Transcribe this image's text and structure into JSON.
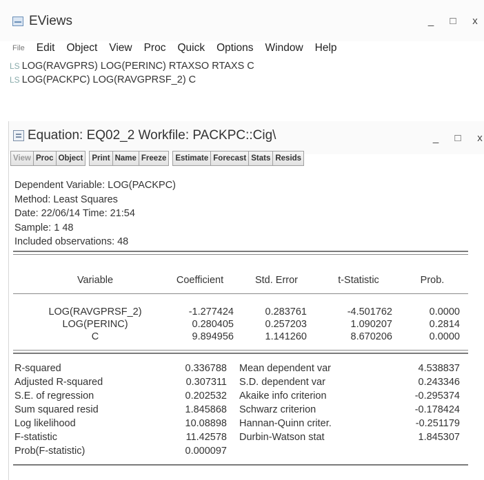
{
  "app": {
    "title": "EViews",
    "window_controls": {
      "minimize": "_",
      "maximize": "□",
      "close": "x"
    }
  },
  "menu": {
    "items": [
      {
        "key": "file",
        "label": "File"
      },
      {
        "key": "edit",
        "label": "Edit"
      },
      {
        "key": "object",
        "label": "Object"
      },
      {
        "key": "view",
        "label": "View"
      },
      {
        "key": "proc",
        "label": "Proc"
      },
      {
        "key": "quick",
        "label": "Quick"
      },
      {
        "key": "options",
        "label": "Options"
      },
      {
        "key": "window",
        "label": "Window"
      },
      {
        "key": "help",
        "label": "Help"
      }
    ]
  },
  "command_window": {
    "lines": [
      {
        "prefix": "LS",
        "text": "LOG(RAVGPRS) LOG(PERINC)  RTAXSO RTAXS C"
      },
      {
        "prefix": "LS",
        "text": "LOG(PACKPC) LOG(RAVGPRSF_2) C"
      }
    ]
  },
  "equation_window": {
    "title": "Equation: EQ02_2   Workfile: PACKPC::Cig\\",
    "window_controls": {
      "minimize": "_",
      "maximize": "□",
      "close": "x"
    },
    "toolbar": [
      {
        "label": "View"
      },
      {
        "label": "Proc"
      },
      {
        "label": "Object"
      },
      {
        "label": "Print"
      },
      {
        "label": "Name"
      },
      {
        "label": "Freeze"
      },
      {
        "label": "Estimate"
      },
      {
        "label": "Forecast"
      },
      {
        "label": "Stats"
      },
      {
        "label": "Resids"
      }
    ],
    "header": {
      "dependent_variable": "Dependent Variable: LOG(PACKPC)",
      "method": "Method: Least Squares",
      "date": "Date: 22/06/14   Time: 21:54",
      "sample": "Sample: 1 48",
      "observations": "Included observations: 48"
    },
    "columns": [
      "Variable",
      "Coefficient",
      "Std. Error",
      "t-Statistic",
      "Prob."
    ],
    "rows": [
      [
        "LOG(RAVGPRSF_2)",
        "-1.277424",
        "0.283761",
        "-4.501762",
        "0.0000"
      ],
      [
        "LOG(PERINC)",
        "0.280405",
        "0.257203",
        "1.090207",
        "0.2814"
      ],
      [
        "C",
        "9.894956",
        "1.141260",
        "8.670206",
        "0.0000"
      ]
    ],
    "stats": [
      {
        "label": "R-squared",
        "value": "0.336788",
        "label2": "Mean dependent var",
        "value2": "4.538837"
      },
      {
        "label": "Adjusted R-squared",
        "value": "0.307311",
        "label2": "S.D. dependent var",
        "value2": "0.243346"
      },
      {
        "label": "S.E. of regression",
        "value": "0.202532",
        "label2": "Akaike info criterion",
        "value2": "-0.295374"
      },
      {
        "label": "Sum squared resid",
        "value": "1.845868",
        "label2": "Schwarz criterion",
        "value2": "-0.178424"
      },
      {
        "label": "Log likelihood",
        "value": "10.08898",
        "label2": "Hannan-Quinn criter.",
        "value2": "-0.251179"
      },
      {
        "label": "F-statistic",
        "value": "11.42578",
        "label2": "Durbin-Watson stat",
        "value2": "1.845307"
      },
      {
        "label": "Prob(F-statistic)",
        "value": "0.000097",
        "label2": "",
        "value2": ""
      }
    ]
  }
}
